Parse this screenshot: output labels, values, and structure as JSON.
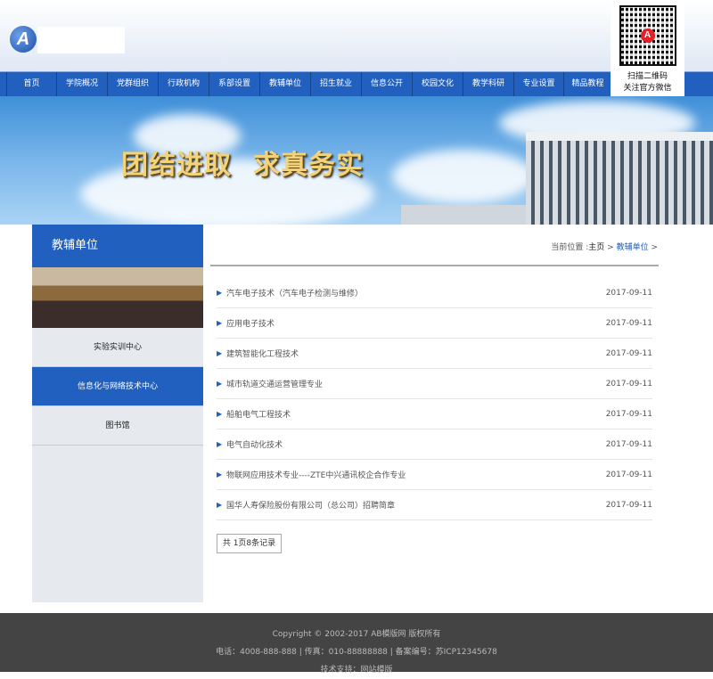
{
  "logo": {
    "letter": "A"
  },
  "qr": {
    "line1": "扫描二维码",
    "line2": "关注官方微信",
    "badge": "A"
  },
  "nav": [
    "首页",
    "学院概况",
    "党群组织",
    "行政机构",
    "系部设置",
    "教辅单位",
    "招生就业",
    "信息公开",
    "校园文化",
    "教学科研",
    "专业设置",
    "精品教程"
  ],
  "banner": {
    "slogan1": "团结进取",
    "slogan2": "求真务实"
  },
  "sidebar": {
    "title": "教辅单位",
    "items": [
      "实验实训中心",
      "信息化与网络技术中心",
      "图书馆"
    ]
  },
  "breadcrumb": {
    "prefix": "当前位置 :",
    "home": "主页",
    "sep": ">",
    "current": "教辅单位"
  },
  "list": [
    {
      "title": "汽车电子技术（汽车电子检测与维修）",
      "date": "2017-09-11"
    },
    {
      "title": "应用电子技术",
      "date": "2017-09-11"
    },
    {
      "title": "建筑智能化工程技术",
      "date": "2017-09-11"
    },
    {
      "title": "城市轨道交通运营管理专业",
      "date": "2017-09-11"
    },
    {
      "title": "船舶电气工程技术",
      "date": "2017-09-11"
    },
    {
      "title": "电气自动化技术",
      "date": "2017-09-11"
    },
    {
      "title": "物联网应用技术专业----ZTE中兴通讯校企合作专业",
      "date": "2017-09-11"
    },
    {
      "title": "国华人寿保险股份有限公司（总公司）招聘简章",
      "date": "2017-09-11"
    }
  ],
  "pager": "共 1页8条记录",
  "footer": {
    "copyright": "Copyright © 2002-2017 AB模版网 版权所有",
    "contact": "电话：4008-888-888 | 传真：010-88888888 | 备案编号：苏ICP12345678",
    "support": "技术支持：网站模版"
  }
}
